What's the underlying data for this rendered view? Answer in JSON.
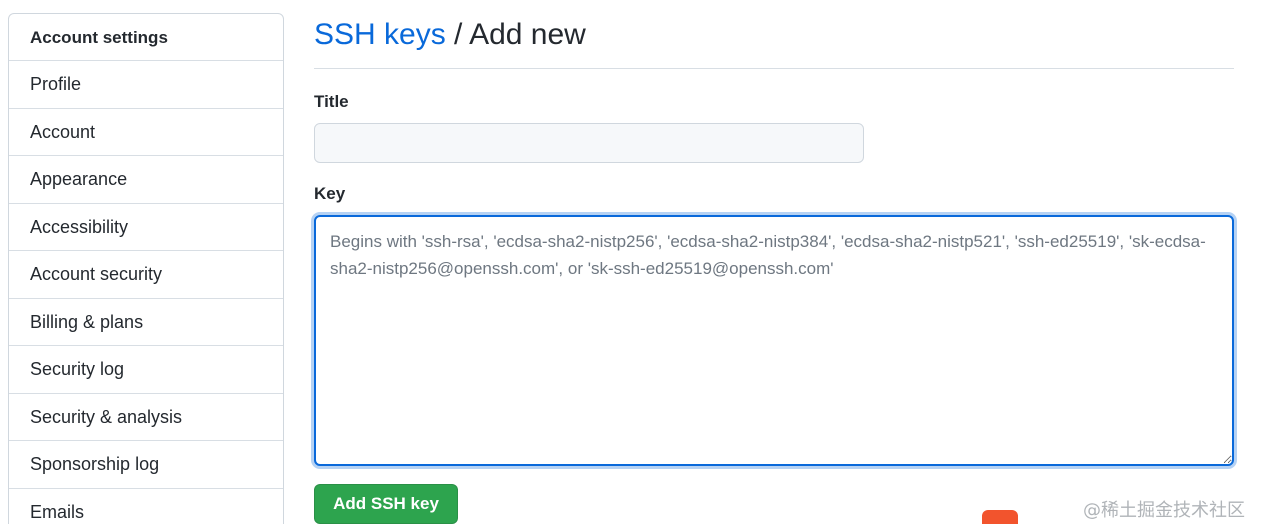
{
  "sidebar": {
    "header": "Account settings",
    "items": [
      {
        "label": "Profile"
      },
      {
        "label": "Account"
      },
      {
        "label": "Appearance"
      },
      {
        "label": "Accessibility"
      },
      {
        "label": "Account security"
      },
      {
        "label": "Billing & plans"
      },
      {
        "label": "Security log"
      },
      {
        "label": "Security & analysis"
      },
      {
        "label": "Sponsorship log"
      },
      {
        "label": "Emails"
      }
    ]
  },
  "header": {
    "breadcrumb_link": "SSH keys",
    "breadcrumb_separator": " / ",
    "breadcrumb_current": "Add new"
  },
  "form": {
    "title_label": "Title",
    "title_value": "",
    "key_label": "Key",
    "key_placeholder": "Begins with 'ssh-rsa', 'ecdsa-sha2-nistp256', 'ecdsa-sha2-nistp384', 'ecdsa-sha2-nistp521', 'ssh-ed25519', 'sk-ecdsa-sha2-nistp256@openssh.com', or 'sk-ssh-ed25519@openssh.com'",
    "submit_label": "Add SSH key"
  },
  "watermark": {
    "text": "@稀土掘金技术社区"
  },
  "colors": {
    "link": "#0969da",
    "primary_button": "#2da44e",
    "focus_border": "#0969da"
  }
}
